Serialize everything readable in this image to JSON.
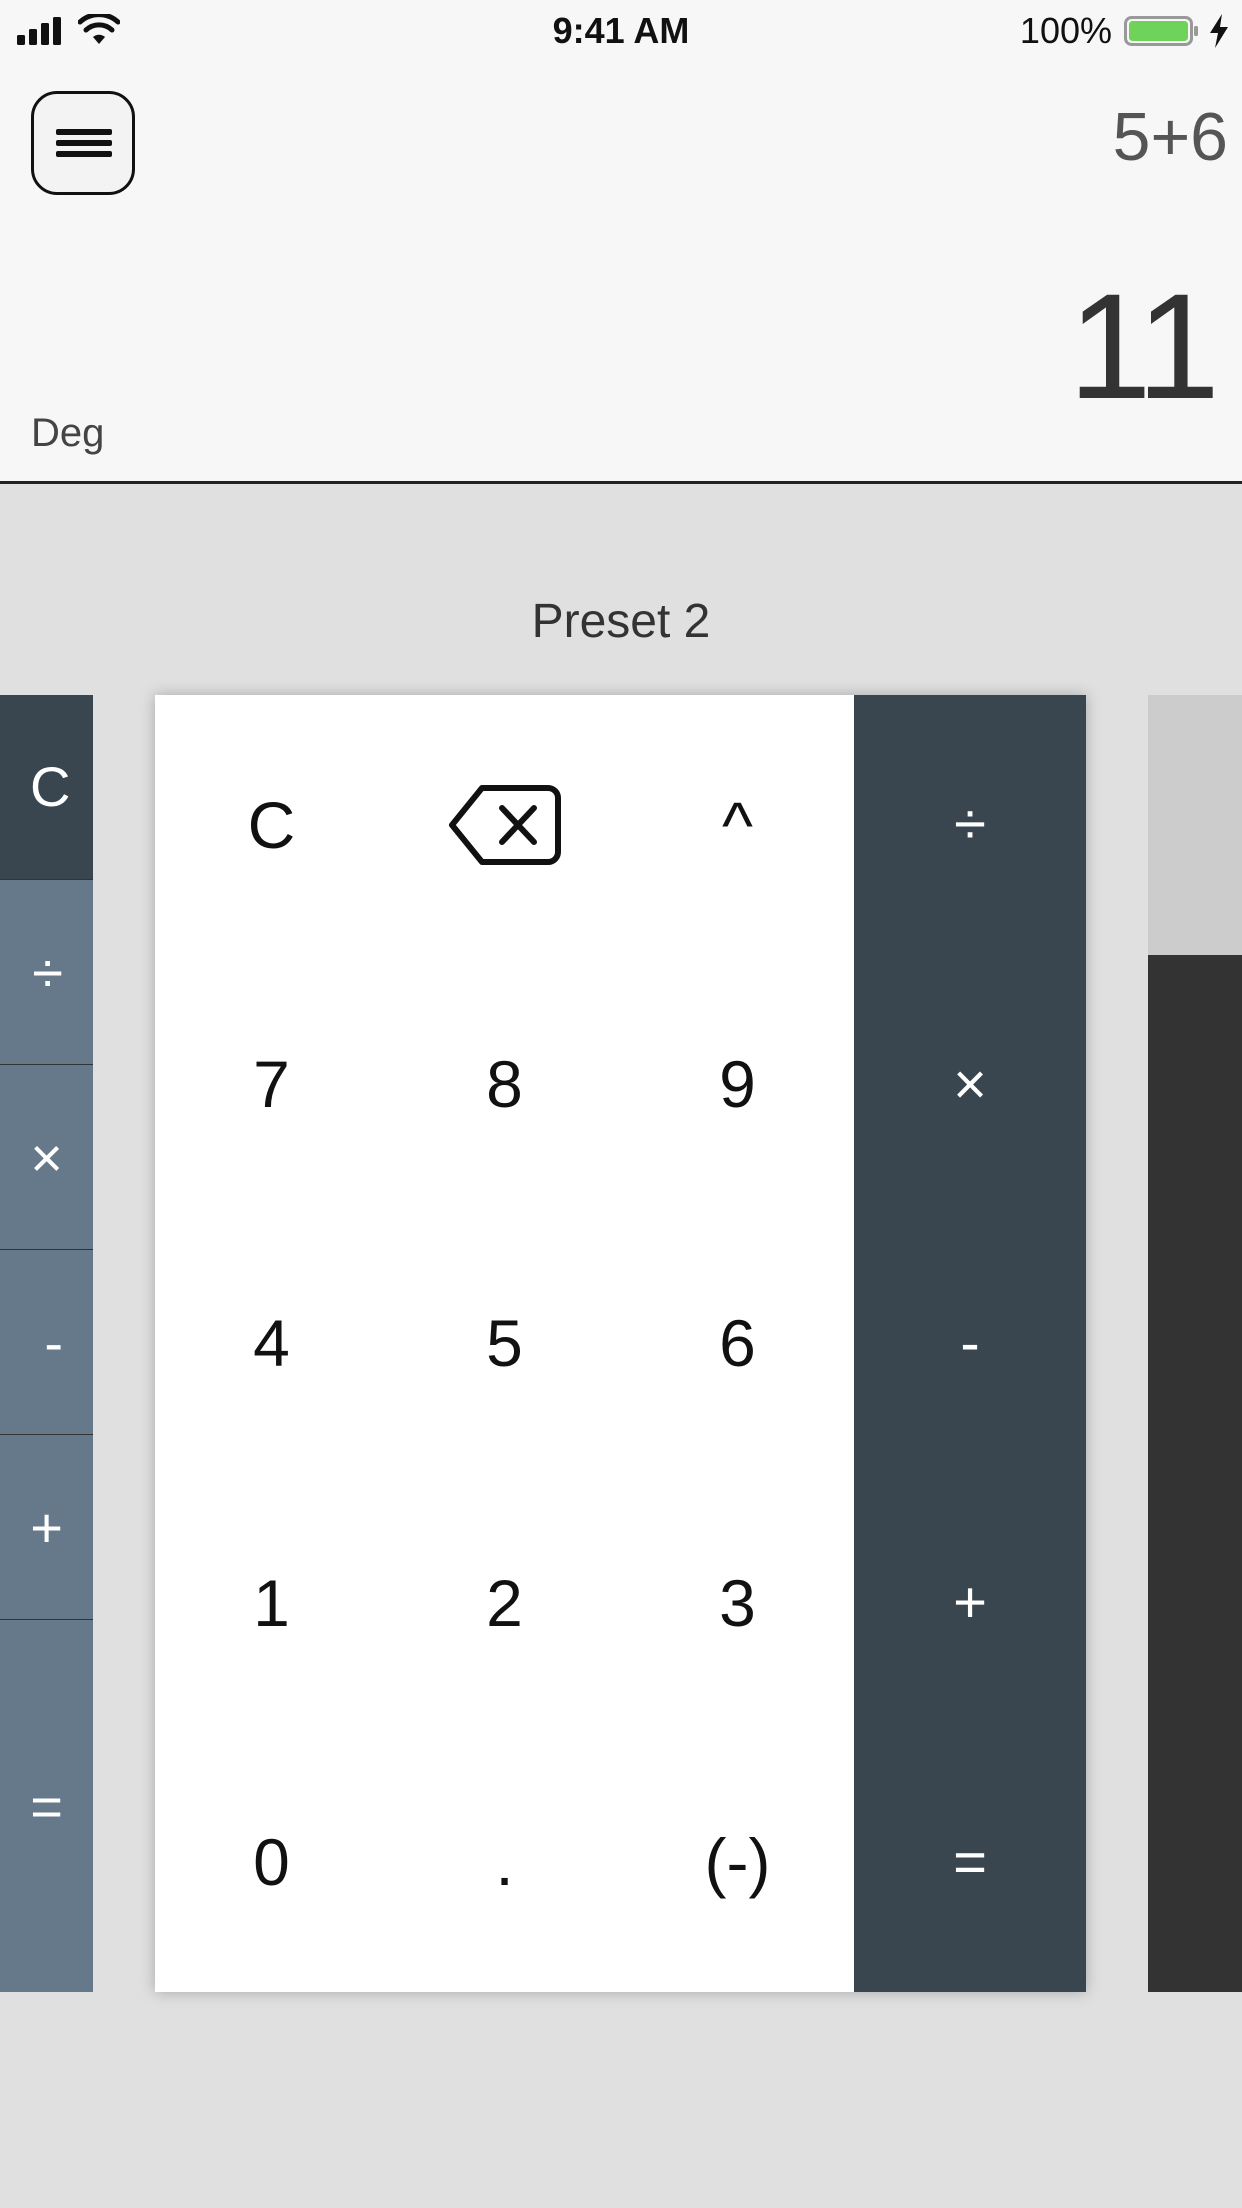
{
  "status_bar": {
    "time": "9:41 AM",
    "battery": "100%"
  },
  "display": {
    "expression": "5+6",
    "result": "11",
    "angle_mode": "Deg"
  },
  "carousel": {
    "preset_title": "Preset 2",
    "left_preview_keys": [
      "C",
      "÷",
      "×",
      "-",
      "+",
      "="
    ],
    "main": {
      "number_keys": [
        "C",
        "backspace",
        "^",
        "7",
        "8",
        "9",
        "4",
        "5",
        "6",
        "1",
        "2",
        "3",
        "0",
        ".",
        "(-)"
      ],
      "operator_keys": [
        "÷",
        "×",
        "-",
        "+",
        "="
      ]
    }
  },
  "colors": {
    "display_bg": "#f7f7f7",
    "app_bg": "#e0e0e0",
    "operator_column": "#3a464f",
    "left_preview_dark": "#3a464f",
    "left_preview_light": "#66798a",
    "right_preview_top": "#cccccc",
    "right_preview_body": "#333333",
    "battery_fill": "#6fd35a"
  }
}
